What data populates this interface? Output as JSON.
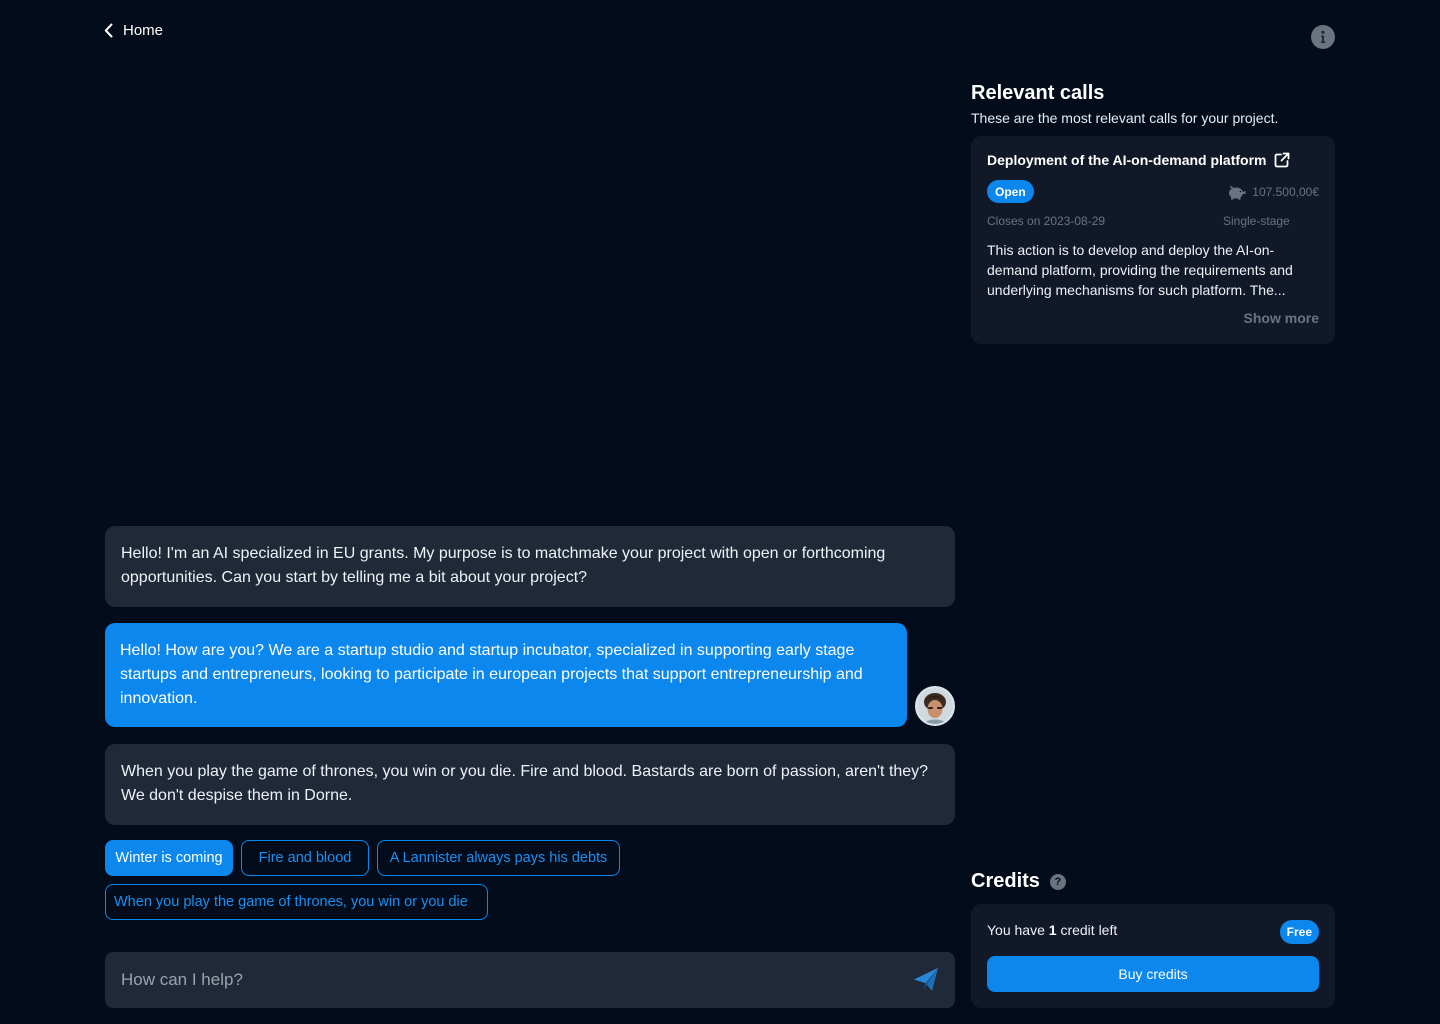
{
  "nav": {
    "back_label": "Home"
  },
  "relevant_calls": {
    "title": "Relevant calls",
    "subtitle": "These are the most relevant calls for your project.",
    "calls": [
      {
        "title": "Deployment of the AI-on-demand platform",
        "status": "Open",
        "amount": "107.500,00€",
        "closes": "Closes on 2023-08-29",
        "stage": "Single-stage",
        "description": "This action is to develop and deploy the AI-on-demand platform, providing the requirements and underlying mechanisms for such platform. The...",
        "show_more": "Show more"
      }
    ]
  },
  "chat": {
    "messages": [
      {
        "role": "assistant",
        "text": "Hello! I'm an AI specialized in EU grants. My purpose is to matchmake your project with open or forthcoming opportunities. Can you start by telling me a bit about your project?"
      },
      {
        "role": "user",
        "text": "Hello! How are you? We are a startup studio and startup incubator, specialized in supporting early stage startups and entrepreneurs, looking to participate in european projects that support entrepreneurship and innovation."
      },
      {
        "role": "assistant",
        "text": "When you play the game of thrones, you win or you die. Fire and blood. Bastards are born of passion, aren't they? We don't despise them in Dorne."
      }
    ],
    "suggestions": [
      "Winter is coming",
      "Fire and blood",
      "A Lannister always pays his debts",
      "When you play the game of thrones, you win or you die"
    ],
    "input": {
      "placeholder": "How can I help?",
      "value": ""
    }
  },
  "credits": {
    "title": "Credits",
    "prefix": "You have ",
    "count": "1",
    "suffix": " credit left",
    "plan": "Free",
    "buy_label": "Buy credits"
  },
  "colors": {
    "background": "#030c1a",
    "accent": "#0b87ee",
    "card": "#111827",
    "bubble": "#1f2937"
  }
}
